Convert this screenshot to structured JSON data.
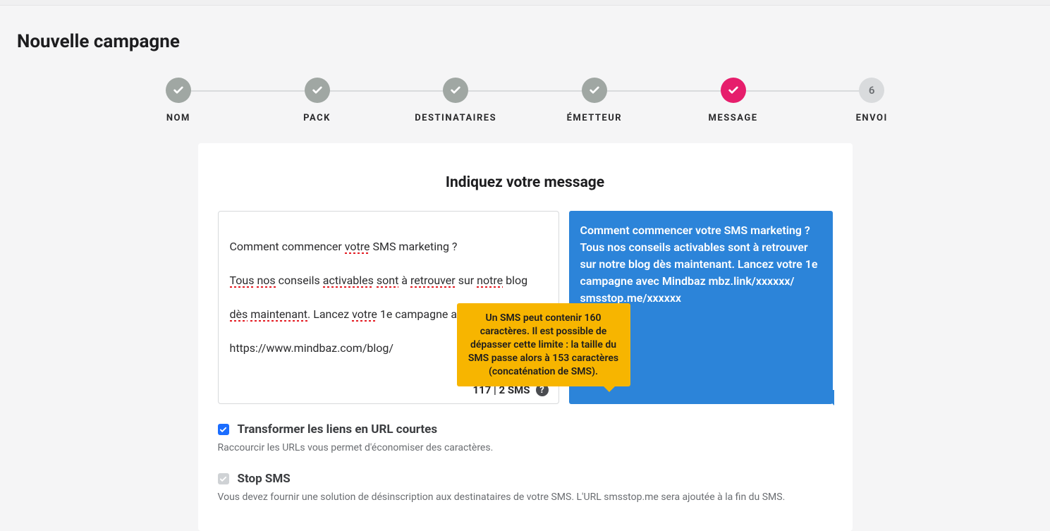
{
  "pageTitle": "Nouvelle campagne",
  "steps": [
    {
      "label": "NOM",
      "state": "done"
    },
    {
      "label": "PACK",
      "state": "done"
    },
    {
      "label": "DESTINATAIRES",
      "state": "done"
    },
    {
      "label": "ÉMETTEUR",
      "state": "done"
    },
    {
      "label": "MESSAGE",
      "state": "active"
    },
    {
      "label": "ENVOI",
      "state": "future",
      "number": "6"
    }
  ],
  "card": {
    "heading": "Indiquez votre message",
    "editor": {
      "line1_plain1": "Comment commencer ",
      "line1_sp1": "votre",
      "line1_plain2": " SMS marketing ?",
      "line2_sp1": "Tous",
      "line2_plain1": " ",
      "line2_sp2": "nos",
      "line2_plain2": " conseils ",
      "line2_sp3": "activables",
      "line2_plain3": " ",
      "line2_sp4": "sont",
      "line2_plain4": " à ",
      "line2_sp5": "retrouver",
      "line2_plain5": " sur ",
      "line2_sp6": "notre",
      "line2_plain6": " blog",
      "line3_sp1": "dès",
      "line3_plain1": " ",
      "line3_sp2": "maintenant",
      "line3_plain2": ". Lancez ",
      "line3_sp3": "votre",
      "line3_plain3": " 1e campagne avec ",
      "line3_sp4": "Mindbaz",
      "line4_plain1": "https://www.mindbaz.com/blog/",
      "counter": "117 | 2 SMS"
    },
    "tooltip": "Un SMS peut contenir 160 caractères. Il est possible de dépasser cette limite : la taille du SMS passe alors à 153 caractères (concaténation de SMS).",
    "preview": "Comment commencer votre SMS marketing ? Tous nos conseils activables sont à retrouver sur notre blog dès maintenant. Lancez votre 1e campagne avec Mindbaz mbz.link/xxxxxx/ smsstop.me/xxxxxx",
    "optShortUrl": {
      "label": "Transformer les liens en URL courtes",
      "help": "Raccourcir les URLs vous permet d'économiser des caractères."
    },
    "optStopSms": {
      "label": "Stop SMS",
      "help": "Vous devez fournir une solution de désinscription aux destinataires de votre SMS. L'URL smsstop.me sera ajoutée à la fin du SMS."
    }
  }
}
